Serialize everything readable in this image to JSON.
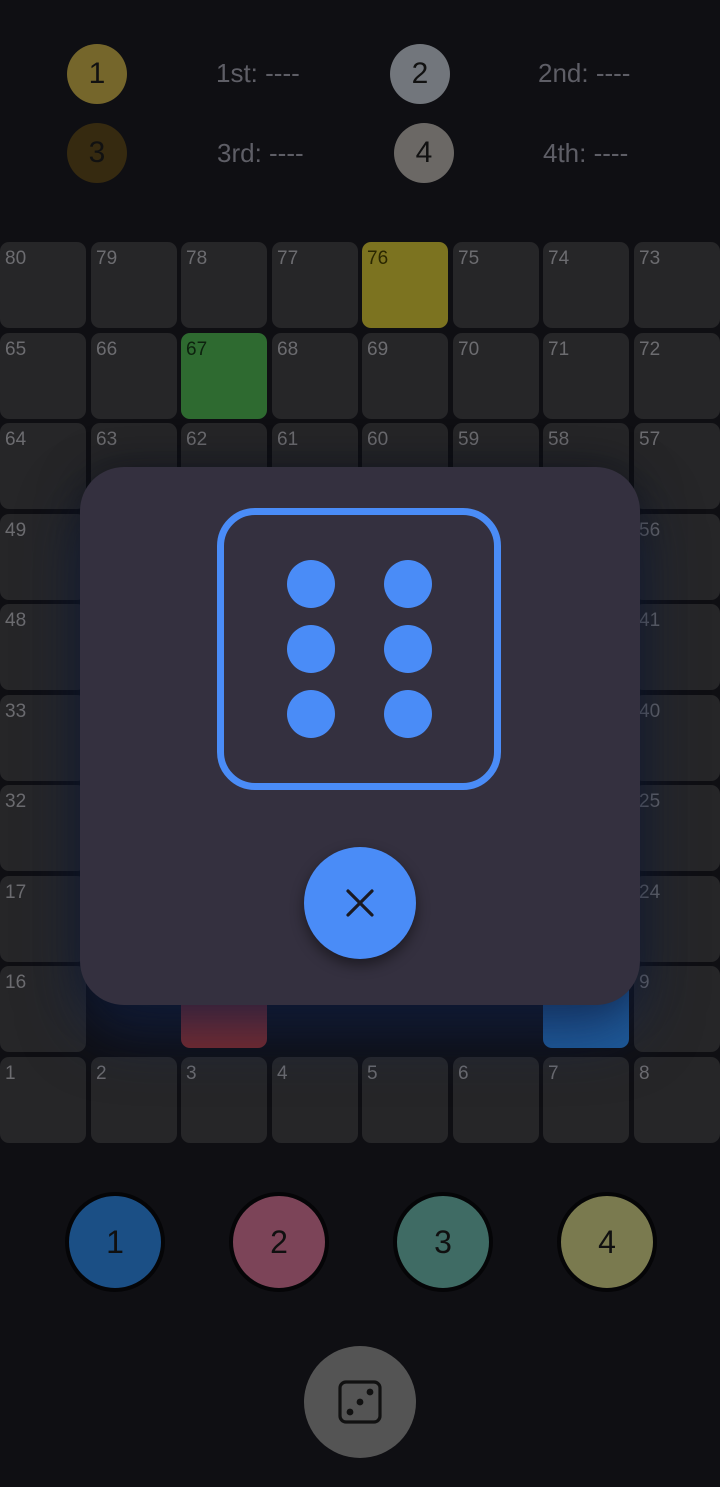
{
  "colors": {
    "background": "#0f0f13",
    "cell": "#262628",
    "modal": "#34303f",
    "accent_blue": "#4a8cf7",
    "yellow_cell": "#7c7320",
    "green_cell": "#2e6a30",
    "red_cell": "#7d2a2a",
    "blue_cell": "#1f5c9b"
  },
  "rankings": [
    {
      "player": "1",
      "label": "1st: ----",
      "color": "#75662b"
    },
    {
      "player": "2",
      "label": "2nd: ----",
      "color": "#72767c"
    },
    {
      "player": "3",
      "label": "3rd: ----",
      "color": "#362a10"
    },
    {
      "player": "4",
      "label": "4th: ----",
      "color": "#6b6865"
    }
  ],
  "board": {
    "rows": [
      [
        "80",
        "79",
        "78",
        "77",
        "76",
        "75",
        "74",
        "73"
      ],
      [
        "65",
        "66",
        "67",
        "68",
        "69",
        "70",
        "71",
        "72"
      ],
      [
        "64",
        "63",
        "62",
        "61",
        "60",
        "59",
        "58",
        "57"
      ],
      [
        "49",
        "",
        "",
        "",
        "",
        "",
        "",
        "56"
      ],
      [
        "48",
        "",
        "",
        "",
        "",
        "",
        "",
        "41"
      ],
      [
        "33",
        "",
        "",
        "",
        "",
        "",
        "",
        "40"
      ],
      [
        "32",
        "",
        "",
        "",
        "",
        "",
        "",
        "25"
      ],
      [
        "17",
        "",
        "",
        "",
        "",
        "",
        "",
        "24"
      ],
      [
        "16",
        "",
        "",
        "",
        "",
        "",
        "",
        "9"
      ],
      [
        "1",
        "2",
        "3",
        "4",
        "5",
        "6",
        "7",
        "8"
      ]
    ],
    "highlighted": {
      "76": "yellow",
      "67": "green"
    }
  },
  "dice_dialog": {
    "result": 6,
    "close_icon": "close-icon",
    "die_icon": "dice-six-icon"
  },
  "players": [
    {
      "label": "1",
      "color": "#1b4f85"
    },
    {
      "label": "2",
      "color": "#7c4458"
    },
    {
      "label": "3",
      "color": "#3f6b64"
    },
    {
      "label": "4",
      "color": "#7a7a4f"
    }
  ],
  "roll_button": {
    "icon": "dice-three-icon"
  }
}
